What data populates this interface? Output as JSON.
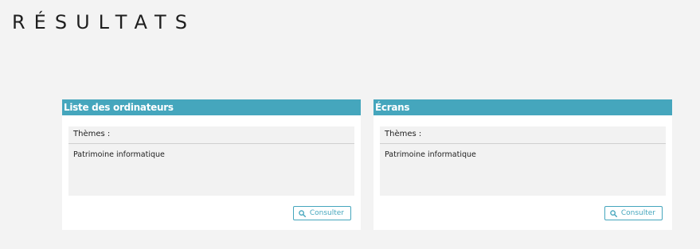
{
  "page": {
    "title": "RÉSULTATS"
  },
  "cards": [
    {
      "title": "Liste des ordinateurs",
      "themes_label": "Thèmes :",
      "themes_value": "Patrimoine informatique",
      "button_label": "Consulter",
      "button_icon": "search-icon"
    },
    {
      "title": "Écrans",
      "themes_label": "Thèmes :",
      "themes_value": "Patrimoine informatique",
      "button_label": "Consulter",
      "button_icon": "search-icon"
    }
  ],
  "colors": {
    "background": "#f3f3f3",
    "accent": "#45a6bd",
    "card_body": "#f2f2f2",
    "card": "#ffffff"
  }
}
